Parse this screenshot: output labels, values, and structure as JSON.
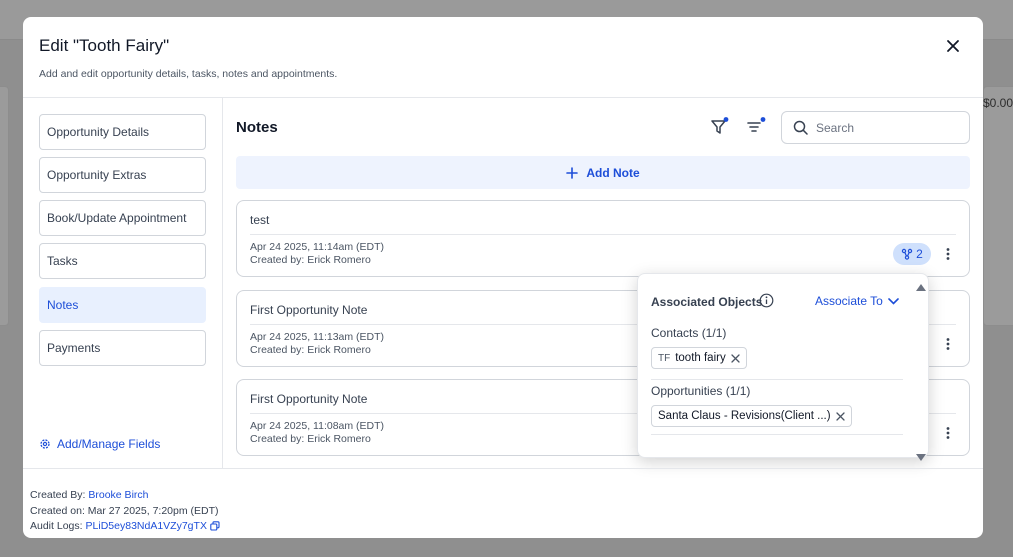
{
  "background": {
    "partial_value": "$0.00"
  },
  "modal": {
    "title": "Edit \"Tooth Fairy\"",
    "subtitle": "Add and edit opportunity details, tasks, notes and appointments."
  },
  "sidebar": {
    "items": [
      {
        "label": "Opportunity Details",
        "active": false
      },
      {
        "label": "Opportunity Extras",
        "active": false
      },
      {
        "label": "Book/Update Appointment",
        "active": false
      },
      {
        "label": "Tasks",
        "active": false
      },
      {
        "label": "Notes",
        "active": true
      },
      {
        "label": "Payments",
        "active": false
      }
    ],
    "manage_fields": "Add/Manage Fields"
  },
  "notes": {
    "title": "Notes",
    "search_placeholder": "Search",
    "add_note": "Add Note",
    "items": [
      {
        "text": "test",
        "date": "Apr 24 2025, 11:14am (EDT)",
        "created_by": "Created by: Erick Romero",
        "assoc_count": "2"
      },
      {
        "text": "First Opportunity Note",
        "date": "Apr 24 2025, 11:13am (EDT)",
        "created_by": "Created by: Erick Romero"
      },
      {
        "text": "First Opportunity Note",
        "date": "Apr 24 2025, 11:08am (EDT)",
        "created_by": "Created by: Erick Romero"
      }
    ]
  },
  "popover": {
    "title": "Associated Objects",
    "associate_to": "Associate To",
    "contacts_label": "Contacts (1/1)",
    "contact_initials": "TF",
    "contact_name": "tooth fairy",
    "opportunities_label": "Opportunities (1/1)",
    "opportunity_name": "Santa Claus - Revisions(Client ...)"
  },
  "footer": {
    "created_by_label": "Created By:",
    "created_by_name": "Brooke Birch",
    "created_on": "Created on: Mar 27 2025, 7:20pm (EDT)",
    "audit_label": "Audit Logs:",
    "audit_id": "PLiD5ey83NdA1VZy7gTX"
  },
  "colors": {
    "accent": "#1d4ed8",
    "active_bg": "#e8f0fe",
    "badge_bg": "#cfe0fc"
  },
  "icons": [
    "close-icon",
    "gear-icon",
    "filter-icon",
    "sort-icon",
    "search-icon",
    "plus-icon",
    "association-icon",
    "kebab-icon",
    "info-icon",
    "chevron-down-icon",
    "x-icon",
    "copy-icon"
  ]
}
